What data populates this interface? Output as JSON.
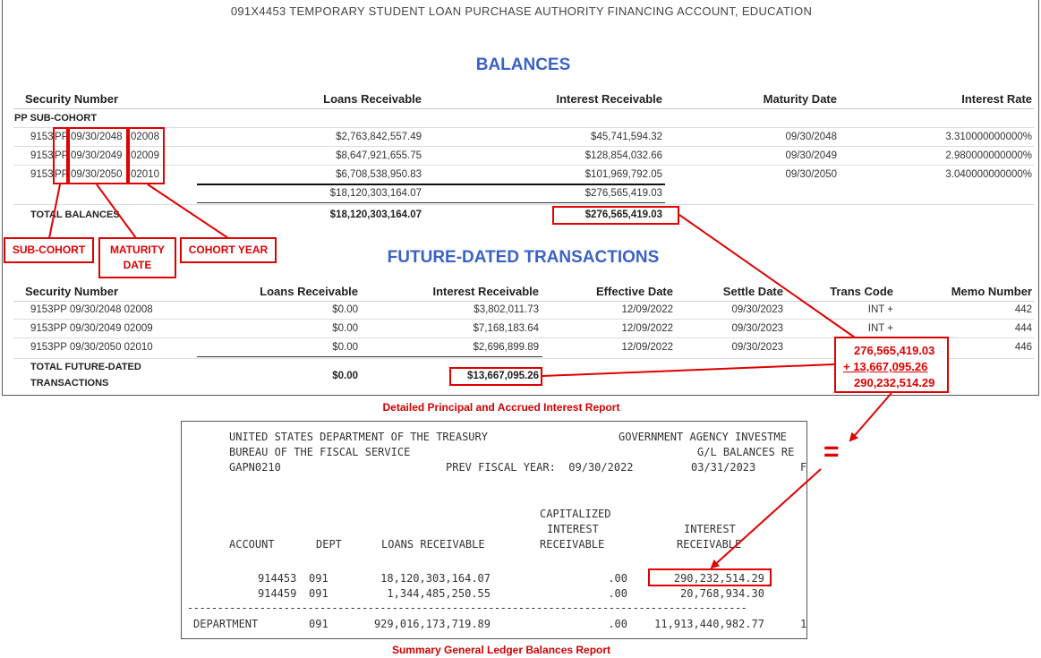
{
  "report": {
    "title": "091X4453 TEMPORARY STUDENT LOAN PURCHASE AUTHORITY FINANCING ACCOUNT, EDUCATION",
    "balances": {
      "heading": "BALANCES",
      "headers": [
        "Security Number",
        "Loans Receivable",
        "Interest Receivable",
        "Maturity Date",
        "Interest Rate"
      ],
      "group_label": "PP SUB-COHORT",
      "rows": [
        {
          "sec_prefix": "9153",
          "sec_sub": "PP",
          "sec_date": "09/30/2048",
          "sec_year": "02008",
          "loans": "$2,763,842,557.49",
          "interest": "$45,741,594.32",
          "maturity": "09/30/2048",
          "rate": "3.310000000000%"
        },
        {
          "sec_prefix": "9153",
          "sec_sub": "PP",
          "sec_date": "09/30/2049",
          "sec_year": "02009",
          "loans": "$8,647,921,655.75",
          "interest": "$128,854,032.66",
          "maturity": "09/30/2049",
          "rate": "2.980000000000%"
        },
        {
          "sec_prefix": "9153",
          "sec_sub": "PP",
          "sec_date": "09/30/2050",
          "sec_year": "02010",
          "loans": "$6,708,538,950.83",
          "interest": "$101,969,792.05",
          "maturity": "09/30/2050",
          "rate": "3.040000000000%"
        }
      ],
      "subtotal_loans": "$18,120,303,164.07",
      "subtotal_interest": "$276,565,419.03",
      "total_label": "TOTAL BALANCES",
      "total_loans": "$18,120,303,164.07",
      "total_interest": "$276,565,419.03"
    },
    "future": {
      "heading": "FUTURE-DATED TRANSACTIONS",
      "headers": [
        "Security Number",
        "Loans Receivable",
        "Interest Receivable",
        "Effective Date",
        "Settle Date",
        "Trans Code",
        "Memo Number"
      ],
      "rows": [
        {
          "security": "9153PP 09/30/2048 02008",
          "loans": "$0.00",
          "interest": "$3,802,011.73",
          "effective": "12/09/2022",
          "settle": "09/30/2023",
          "code": "INT +",
          "memo": "442"
        },
        {
          "security": "9153PP 09/30/2049 02009",
          "loans": "$0.00",
          "interest": "$7,168,183.64",
          "effective": "12/09/2022",
          "settle": "09/30/2023",
          "code": "INT +",
          "memo": "444"
        },
        {
          "security": "9153PP 09/30/2050 02010",
          "loans": "$0.00",
          "interest": "$2,696,899.89",
          "effective": "12/09/2022",
          "settle": "09/30/2023",
          "code": "",
          "memo": "446"
        }
      ],
      "total_label_1": "TOTAL FUTURE-DATED",
      "total_label_2": "TRANSACTIONS",
      "total_loans": "$0.00",
      "total_interest": "$13,667,095.26"
    }
  },
  "annotations": {
    "sub_cohort": "SUB-COHORT",
    "maturity_1": "MATURITY",
    "maturity_2": "DATE",
    "cohort_year": "COHORT YEAR",
    "sum_line_1": "276,565,419.03",
    "sum_line_2": "+  13,667,095.26",
    "sum_line_3": "290,232,514.29",
    "equals": "=",
    "caption_top": "Detailed Principal and Accrued Interest Report",
    "caption_bottom": "Summary General Ledger Balances Report"
  },
  "ledger": {
    "line1_left": "UNITED STATES DEPARTMENT OF THE TREASURY",
    "line1_right": "GOVERNMENT AGENCY INVESTME",
    "line2_left": "BUREAU OF THE FISCAL SERVICE",
    "line2_right": "G/L BALANCES RE",
    "line3_left": "GAPN0210",
    "line3_mid": "PREV FISCAL YEAR:  09/30/2022",
    "line3_date": "03/31/2023",
    "line3_tail": "F",
    "cap_head_1": "CAPITALIZED",
    "cap_head_2": "INTEREST",
    "cap_head_3": "RECEIVABLE",
    "int_head_1": "INTEREST",
    "int_head_2": "RECEIVABLE",
    "col_account": "ACCOUNT",
    "col_dept": "DEPT",
    "col_loans": "LOANS RECEIVABLE",
    "rows": [
      {
        "account": "914453",
        "dept": "091",
        "loans": "18,120,303,164.07",
        "cap": ".00",
        "interest": "290,232,514.29"
      },
      {
        "account": "914459",
        "dept": "091",
        "loans": "1,344,485,250.55",
        "cap": ".00",
        "interest": "20,768,934.30"
      }
    ],
    "dashes": "---------------------------------------------------------------------------------------------",
    "dept_label": "DEPARTMENT",
    "dept_code": "091",
    "dept_loans": "929,016,173,719.89",
    "dept_cap": ".00",
    "dept_interest": "11,913,440,982.77",
    "dept_tail": "1"
  },
  "colors": {
    "accent": "#3a62c5",
    "annotation": "#e00000"
  }
}
